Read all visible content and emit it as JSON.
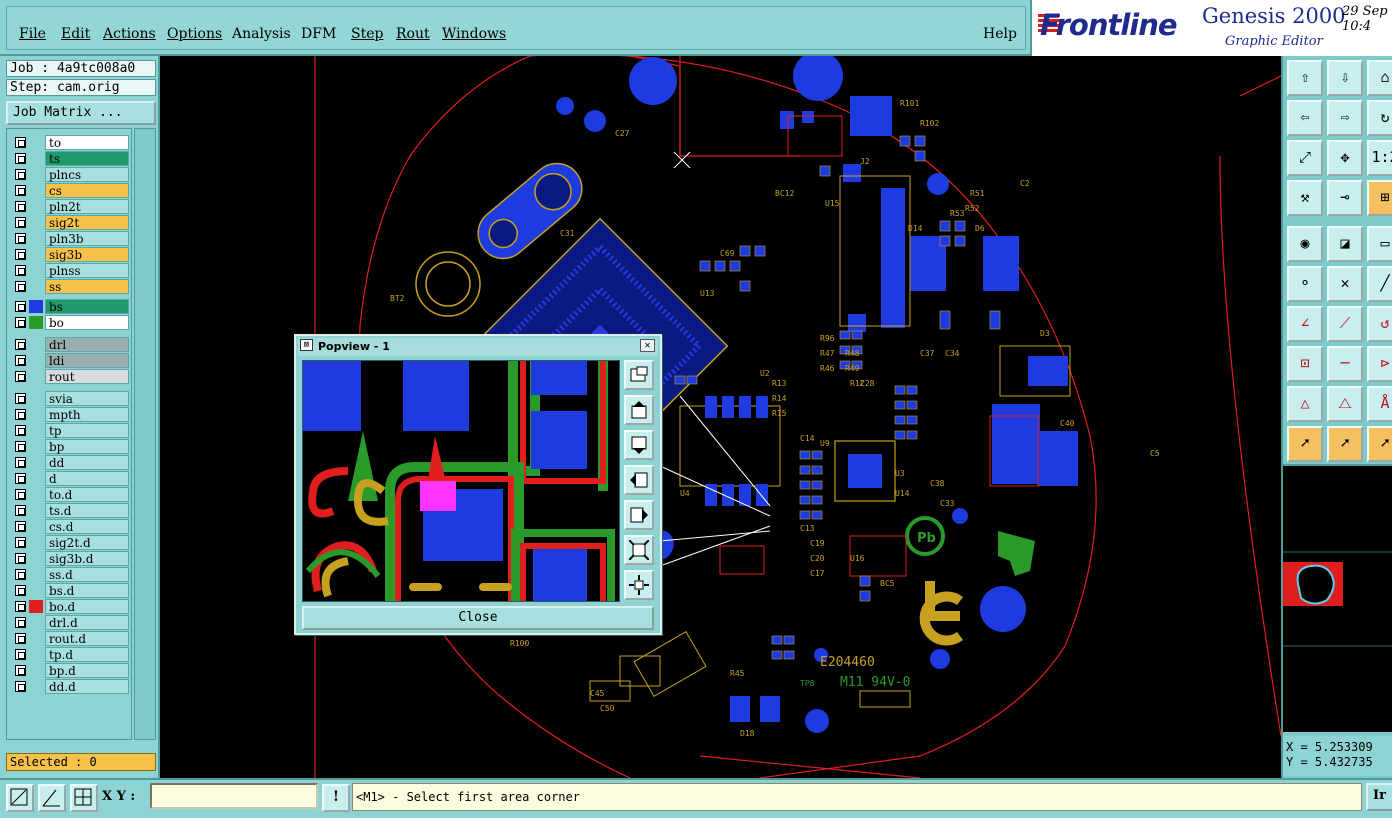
{
  "menu": {
    "items": [
      {
        "label": "File"
      },
      {
        "label": "Edit"
      },
      {
        "label": "Actions"
      },
      {
        "label": "Options"
      },
      {
        "label": "Analysis"
      },
      {
        "label": "DFM"
      },
      {
        "label": "Step"
      },
      {
        "label": "Rout"
      },
      {
        "label": "Windows"
      }
    ],
    "help": "Help"
  },
  "logo": {
    "brand": "Frontline",
    "product": "Genesis 2000",
    "subtitle": "Graphic Editor",
    "date": "29 Sep\n10:4"
  },
  "job": {
    "job_line": "Job : 4a9tc008a0",
    "step_line": "Step: cam.orig",
    "matrix_button": "Job Matrix ...",
    "selected": "Selected : 0"
  },
  "layers": [
    {
      "name": "to",
      "bg": "#ffffff",
      "swatch": ""
    },
    {
      "name": "ts",
      "bg": "#1f9a6a",
      "swatch": ""
    },
    {
      "name": "plncs",
      "bg": "#a8e0e0",
      "swatch": ""
    },
    {
      "name": "cs",
      "bg": "#f7c24a",
      "swatch": ""
    },
    {
      "name": "pln2t",
      "bg": "#a8e0e0",
      "swatch": ""
    },
    {
      "name": "sig2t",
      "bg": "#f7c24a",
      "swatch": ""
    },
    {
      "name": "pln3b",
      "bg": "#a8e0e0",
      "swatch": ""
    },
    {
      "name": "sig3b",
      "bg": "#f7c24a",
      "swatch": ""
    },
    {
      "name": "plnss",
      "bg": "#a8e0e0",
      "swatch": ""
    },
    {
      "name": "ss",
      "bg": "#f7c24a",
      "swatch": ""
    },
    {
      "name": "bs",
      "bg": "#1f9a6a",
      "swatch": "#1e3be0"
    },
    {
      "name": "bo",
      "bg": "#ffffff",
      "swatch": "#2a9a2a"
    },
    {
      "name": "drl",
      "bg": "#9ab0b0",
      "swatch": ""
    },
    {
      "name": "ldi",
      "bg": "#9ab0b0",
      "swatch": ""
    },
    {
      "name": "rout",
      "bg": "#d8dcdc",
      "swatch": ""
    },
    {
      "name": "svia",
      "bg": "#a8e0e0",
      "swatch": ""
    },
    {
      "name": "mpth",
      "bg": "#a8e0e0",
      "swatch": ""
    },
    {
      "name": "tp",
      "bg": "#a8e0e0",
      "swatch": ""
    },
    {
      "name": "bp",
      "bg": "#a8e0e0",
      "swatch": ""
    },
    {
      "name": "dd",
      "bg": "#a8e0e0",
      "swatch": ""
    },
    {
      "name": "d",
      "bg": "#a8e0e0",
      "swatch": ""
    },
    {
      "name": "to.d",
      "bg": "#a8e0e0",
      "swatch": ""
    },
    {
      "name": "ts.d",
      "bg": "#a8e0e0",
      "swatch": ""
    },
    {
      "name": "cs.d",
      "bg": "#a8e0e0",
      "swatch": ""
    },
    {
      "name": "sig2t.d",
      "bg": "#a8e0e0",
      "swatch": ""
    },
    {
      "name": "sig3b.d",
      "bg": "#a8e0e0",
      "swatch": ""
    },
    {
      "name": "ss.d",
      "bg": "#a8e0e0",
      "swatch": ""
    },
    {
      "name": "bs.d",
      "bg": "#a8e0e0",
      "swatch": ""
    },
    {
      "name": "bo.d",
      "bg": "#a8e0e0",
      "swatch": "#e01e1e"
    },
    {
      "name": "drl.d",
      "bg": "#a8e0e0",
      "swatch": ""
    },
    {
      "name": "rout.d",
      "bg": "#a8e0e0",
      "swatch": ""
    },
    {
      "name": "tp.d",
      "bg": "#a8e0e0",
      "swatch": ""
    },
    {
      "name": "bp.d",
      "bg": "#a8e0e0",
      "swatch": ""
    },
    {
      "name": "dd.d",
      "bg": "#a8e0e0",
      "swatch": ""
    }
  ],
  "board_labels": {
    "e_code": "E204460",
    "ul_mark": "M11 94V-0",
    "tp_mark": "TP8",
    "pb_mark": "Pb",
    "refs": [
      "J2",
      "U15",
      "BC12",
      "R101",
      "R102",
      "D14",
      "D6",
      "R48",
      "R49",
      "C28",
      "U9",
      "U3",
      "U14",
      "R13",
      "R14",
      "R15",
      "R12",
      "C14",
      "C13",
      "C19",
      "C20",
      "C17",
      "U16",
      "BC5",
      "C37",
      "C34",
      "C38",
      "C33",
      "R100",
      "D18",
      "R45",
      "BT2",
      "D3",
      "U2",
      "U4",
      "C2",
      "C5",
      "R51",
      "R52",
      "R53",
      "R96",
      "R47",
      "R46",
      "C27",
      "C31",
      "C40",
      "C45",
      "C50",
      "C69",
      "U13"
    ]
  },
  "popview": {
    "title": "Popview - 1",
    "close_label": "Close",
    "title_close": "✕"
  },
  "right_tools": {
    "icons": [
      "page-up-icon",
      "page-down-icon",
      "home-icon",
      "pan-left-icon",
      "pan-right-icon",
      "redraw-icon",
      "zoom-fit-icon",
      "zoom-center-icon",
      "scale-icon",
      "measure-icon",
      "snap-icon",
      "grid-icon",
      "select-touch-icon",
      "select-area-icon",
      "ruler-icon",
      "connect-icon",
      "cross-icon",
      "line-icon",
      "angle-icon",
      "diagonal-icon",
      "rotate-icon",
      "pad-icon",
      "horizontal-icon",
      "arrow-right-icon",
      "triangle-icon",
      "triangle-select-icon",
      "triangle-text-icon",
      "pointer-icon",
      "pointer-box-icon",
      "pointer-circle-icon"
    ]
  },
  "coords": {
    "x_line": "X = 5.253309",
    "y_line": "Y = 5.432735"
  },
  "status": {
    "xy_label": "X Y :",
    "xy_value": "",
    "bang": "!",
    "message": "<M1> - Select first area corner",
    "right": "Ir"
  },
  "colors": {
    "panel": "#8ed3d3",
    "pad": "#1e3be0",
    "silk": "#c8a020",
    "outline": "#e01e1e",
    "mask": "#2a9a2a"
  }
}
